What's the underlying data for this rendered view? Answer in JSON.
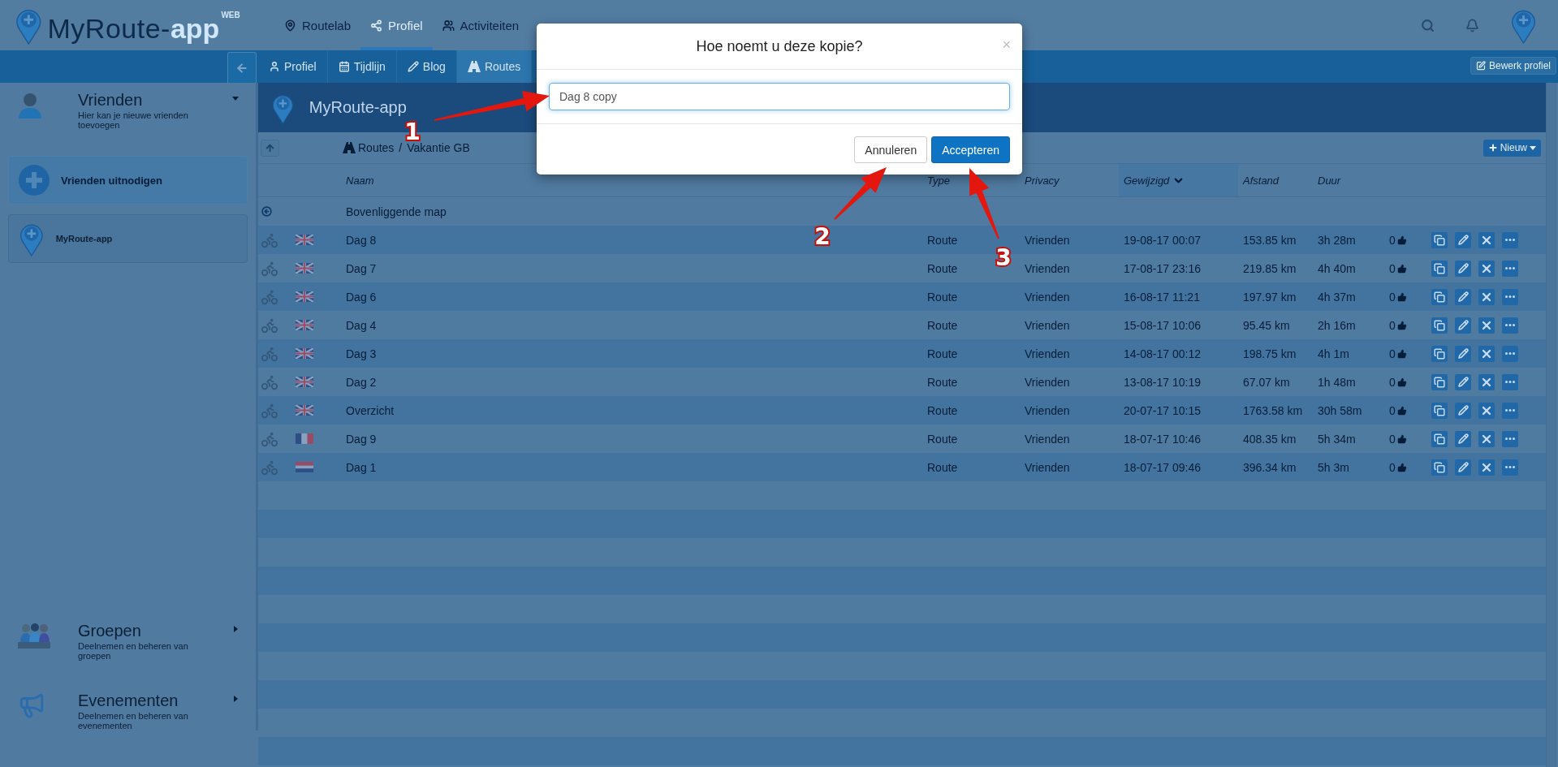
{
  "header": {
    "logo": {
      "name": "MyRoute-",
      "accent": "app",
      "badge": "WEB"
    },
    "nav": [
      {
        "label": "Routelab",
        "selected": false
      },
      {
        "label": "Profiel",
        "selected": true
      },
      {
        "label": "Activiteiten",
        "selected": false
      }
    ]
  },
  "subnav": {
    "tabs": [
      {
        "label": "Profiel",
        "selected": false
      },
      {
        "label": "Tijdlijn",
        "selected": false
      },
      {
        "label": "Blog",
        "selected": false
      },
      {
        "label": "Routes",
        "selected": true
      }
    ],
    "action": "Bewerk profiel"
  },
  "sidebar": {
    "sections": [
      {
        "kind": "friends",
        "title": "Vrienden",
        "subtitle": "Hier kan je nieuwe vrienden toevoegen",
        "expanded": true,
        "items": [
          {
            "kind": "invite",
            "label": "Vrienden uitnodigen"
          },
          {
            "kind": "friend",
            "label": "MyRoute-app"
          }
        ]
      }
    ],
    "footer_sections": [
      {
        "kind": "groups",
        "title": "Groepen",
        "subtitle": "Deelnemen en beheren van groepen",
        "expanded": false
      },
      {
        "kind": "events",
        "title": "Evenementen",
        "subtitle": "Deelnemen en beheren van evenementen",
        "expanded": false
      }
    ]
  },
  "content": {
    "title": "MyRoute-app",
    "breadcrumb": [
      "Routes",
      "Vakantie GB"
    ],
    "breadcrumb_separator": "/",
    "new_button": "Nieuw",
    "columns": [
      {
        "label": "Naam",
        "sorted": false
      },
      {
        "label": "Type",
        "sorted": false
      },
      {
        "label": "Privacy",
        "sorted": false
      },
      {
        "label": "Gewijzigd",
        "sorted": true
      },
      {
        "label": "Afstand",
        "sorted": false
      },
      {
        "label": "Duur",
        "sorted": false
      }
    ],
    "parent_row": "Bovenliggende map",
    "rows": [
      {
        "kind": "gb",
        "name": "Dag 8",
        "type": "Route",
        "privacy": "Vrienden",
        "modified": "19-08-17 00:07",
        "distance": "153.85 km",
        "duration": "3h 28m",
        "likes": "0"
      },
      {
        "kind": "gb",
        "name": "Dag 7",
        "type": "Route",
        "privacy": "Vrienden",
        "modified": "17-08-17 23:16",
        "distance": "219.85 km",
        "duration": "4h 40m",
        "likes": "0"
      },
      {
        "kind": "gb",
        "name": "Dag 6",
        "type": "Route",
        "privacy": "Vrienden",
        "modified": "16-08-17 11:21",
        "distance": "197.97 km",
        "duration": "4h 37m",
        "likes": "0"
      },
      {
        "kind": "gb",
        "name": "Dag 4",
        "type": "Route",
        "privacy": "Vrienden",
        "modified": "15-08-17 10:06",
        "distance": "95.45 km",
        "duration": "2h 16m",
        "likes": "0"
      },
      {
        "kind": "gb",
        "name": "Dag 3",
        "type": "Route",
        "privacy": "Vrienden",
        "modified": "14-08-17 00:12",
        "distance": "198.75 km",
        "duration": "4h 1m",
        "likes": "0"
      },
      {
        "kind": "gb",
        "name": "Dag 2",
        "type": "Route",
        "privacy": "Vrienden",
        "modified": "13-08-17 10:19",
        "distance": "67.07 km",
        "duration": "1h 48m",
        "likes": "0"
      },
      {
        "kind": "gb",
        "name": "Overzicht",
        "type": "Route",
        "privacy": "Vrienden",
        "modified": "20-07-17 10:15",
        "distance": "1763.58 km",
        "duration": "30h 58m",
        "likes": "0"
      },
      {
        "kind": "fr",
        "name": "Dag 9",
        "type": "Route",
        "privacy": "Vrienden",
        "modified": "18-07-17 10:46",
        "distance": "408.35 km",
        "duration": "5h 34m",
        "likes": "0"
      },
      {
        "kind": "nl",
        "name": "Dag 1",
        "type": "Route",
        "privacy": "Vrienden",
        "modified": "18-07-17 09:46",
        "distance": "396.34 km",
        "duration": "5h 3m",
        "likes": "0"
      }
    ]
  },
  "dialog": {
    "title": "Hoe noemt u deze kopie?",
    "close": "×",
    "value": "Dag 8 copy",
    "buttons": [
      {
        "label": "Annuleren",
        "primary": false
      },
      {
        "label": "Accepteren",
        "primary": true
      }
    ]
  },
  "annotations": [
    {
      "label": "1"
    },
    {
      "label": "2"
    },
    {
      "label": "3"
    }
  ]
}
